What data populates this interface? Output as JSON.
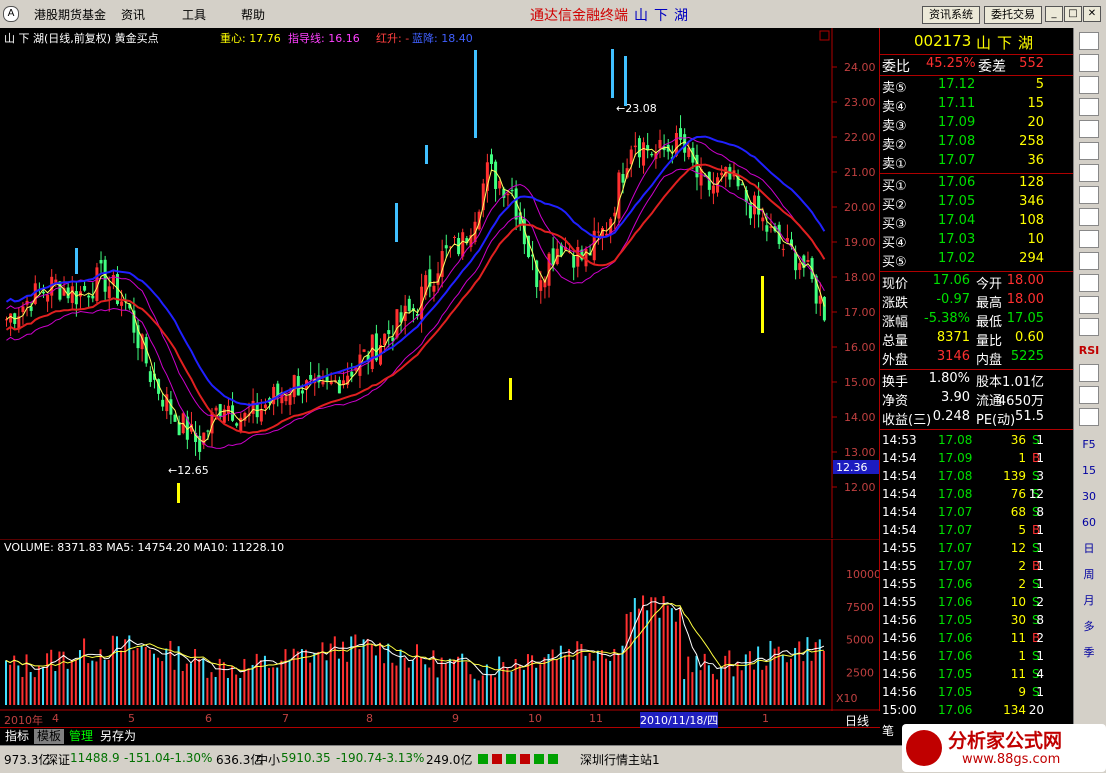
{
  "window": {
    "menu": [
      "港股期货基金",
      "资讯",
      "工具",
      "帮助"
    ],
    "title_prefix": "通达信金融终端",
    "title_stock": "山下湖",
    "buttons": [
      "资讯系统",
      "委托交易"
    ]
  },
  "main_chart": {
    "header_left": "山 下 湖(日线,前复权) 黄金买点",
    "header_center_label": "重心: 17.76",
    "header_guide": "指导线: 16.16",
    "header_rise": "红升: -",
    "header_fall": "蓝降: 18.40",
    "price_ticks": [
      "24.00",
      "23.00",
      "22.00",
      "21.00",
      "20.00",
      "19.00",
      "18.00",
      "17.00",
      "16.00",
      "15.00",
      "14.00",
      "13.00",
      "12.00"
    ],
    "current_price_label": "12.36",
    "high_mark": "23.08",
    "low_mark": "12.65"
  },
  "vol_chart": {
    "header": "VOLUME: 8371.83  MA5: 14754.20  MA10: 11228.10",
    "ticks": [
      "10000",
      "7500",
      "5000",
      "2500"
    ],
    "unit": "X10"
  },
  "timeline": {
    "labels": [
      "2010年",
      "4",
      "5",
      "6",
      "7",
      "8",
      "9",
      "10",
      "11",
      "2010/11/18/四",
      "1"
    ],
    "period": "日线"
  },
  "chart_data": {
    "type": "candlestick",
    "title": "山下湖(日线,前复权)",
    "ylim": [
      11.6,
      24.5
    ],
    "close_approx": [
      16.8,
      17.4,
      17.8,
      17.5,
      18.0,
      17.2,
      15.2,
      14.0,
      13.2,
      14.5,
      13.9,
      14.5,
      15.0,
      14.6,
      15.2,
      15.8,
      16.5,
      17.1,
      18.5,
      19.0,
      21.0,
      20.5,
      18.0,
      19.0,
      18.5,
      19.5,
      22.0,
      21.5,
      21.8,
      20.5,
      20.8,
      20.0,
      19.0,
      18.5,
      17.06
    ],
    "volume_ticks": [
      2500,
      5000,
      7500,
      10000
    ]
  },
  "panel": {
    "code": "002173",
    "name": "山下湖",
    "webi_label": "委比",
    "webi_value": "45.25%",
    "wecha_label": "委差",
    "wecha_value": "552",
    "sell": [
      {
        "label": "卖⑤",
        "price": "17.12",
        "vol": "5"
      },
      {
        "label": "卖④",
        "price": "17.11",
        "vol": "15"
      },
      {
        "label": "卖③",
        "price": "17.09",
        "vol": "20"
      },
      {
        "label": "卖②",
        "price": "17.08",
        "vol": "258"
      },
      {
        "label": "卖①",
        "price": "17.07",
        "vol": "36"
      }
    ],
    "buy": [
      {
        "label": "买①",
        "price": "17.06",
        "vol": "128"
      },
      {
        "label": "买②",
        "price": "17.05",
        "vol": "346"
      },
      {
        "label": "买③",
        "price": "17.04",
        "vol": "108"
      },
      {
        "label": "买④",
        "price": "17.03",
        "vol": "10"
      },
      {
        "label": "买⑤",
        "price": "17.02",
        "vol": "294"
      }
    ],
    "stats": [
      {
        "l1": "现价",
        "v1": "17.06",
        "l2": "今开",
        "v2": "18.00",
        "c1": "green",
        "c2": "red"
      },
      {
        "l1": "涨跌",
        "v1": "-0.97",
        "l2": "最高",
        "v2": "18.00",
        "c1": "green",
        "c2": "red"
      },
      {
        "l1": "涨幅",
        "v1": "-5.38%",
        "l2": "最低",
        "v2": "17.05",
        "c1": "green",
        "c2": "green"
      },
      {
        "l1": "总量",
        "v1": "8371",
        "l2": "量比",
        "v2": "0.60",
        "c1": "yellow",
        "c2": "yellow"
      },
      {
        "l1": "外盘",
        "v1": "3146",
        "l2": "内盘",
        "v2": "5225",
        "c1": "red",
        "c2": "green"
      }
    ],
    "fin": [
      {
        "l1": "换手",
        "v1": "1.80%",
        "l2": "股本",
        "v2": "1.01亿"
      },
      {
        "l1": "净资",
        "v1": "3.90",
        "l2": "流通",
        "v2": "4650万"
      },
      {
        "l1": "收益(三)",
        "v1": "0.248",
        "l2": "PE(动)",
        "v2": "51.5"
      }
    ],
    "ticks": [
      {
        "t": "14:53",
        "p": "17.08",
        "v": "36",
        "s": "S",
        "n": "1"
      },
      {
        "t": "14:54",
        "p": "17.09",
        "v": "1",
        "s": "B",
        "n": "1"
      },
      {
        "t": "14:54",
        "p": "17.08",
        "v": "139",
        "s": "S",
        "n": "3"
      },
      {
        "t": "14:54",
        "p": "17.08",
        "v": "76",
        "s": "S",
        "n": "12"
      },
      {
        "t": "14:54",
        "p": "17.07",
        "v": "68",
        "s": "S",
        "n": "8"
      },
      {
        "t": "14:54",
        "p": "17.07",
        "v": "5",
        "s": "B",
        "n": "1"
      },
      {
        "t": "14:55",
        "p": "17.07",
        "v": "12",
        "s": "S",
        "n": "1"
      },
      {
        "t": "14:55",
        "p": "17.07",
        "v": "2",
        "s": "B",
        "n": "1"
      },
      {
        "t": "14:55",
        "p": "17.06",
        "v": "2",
        "s": "S",
        "n": "1"
      },
      {
        "t": "14:55",
        "p": "17.06",
        "v": "10",
        "s": "S",
        "n": "2"
      },
      {
        "t": "14:56",
        "p": "17.05",
        "v": "30",
        "s": "S",
        "n": "8"
      },
      {
        "t": "14:56",
        "p": "17.06",
        "v": "11",
        "s": "B",
        "n": "2"
      },
      {
        "t": "14:56",
        "p": "17.06",
        "v": "1",
        "s": "S",
        "n": "1"
      },
      {
        "t": "14:56",
        "p": "17.05",
        "v": "11",
        "s": "S",
        "n": "4"
      },
      {
        "t": "14:56",
        "p": "17.05",
        "v": "9",
        "s": "S",
        "n": "1"
      },
      {
        "t": "15:00",
        "p": "17.06",
        "v": "134",
        "s": "",
        "n": "20"
      }
    ],
    "bottom_label": "笔"
  },
  "sidebar": {
    "labels": [
      "F5",
      "15",
      "30",
      "60",
      "日",
      "周",
      "月",
      "多",
      "季"
    ],
    "rsi": "RSI"
  },
  "bottom_tabs": [
    "指标",
    "模板",
    "管理",
    "另存为"
  ],
  "status": {
    "amount1": "973.3亿",
    "sz_label": "深证",
    "sz_value": "11488.9",
    "sz_change": "-151.04",
    "sz_pct": "-1.30%",
    "amount2": "636.3亿",
    "zx_label": "中小",
    "zx_value": "5910.35",
    "zx_change": "-190.74",
    "zx_pct": "-3.13%",
    "amount3": "249.0亿",
    "server": "深圳行情主站1",
    "watermark": "分析家公式网",
    "watermark_url": "www.88gs.com"
  }
}
